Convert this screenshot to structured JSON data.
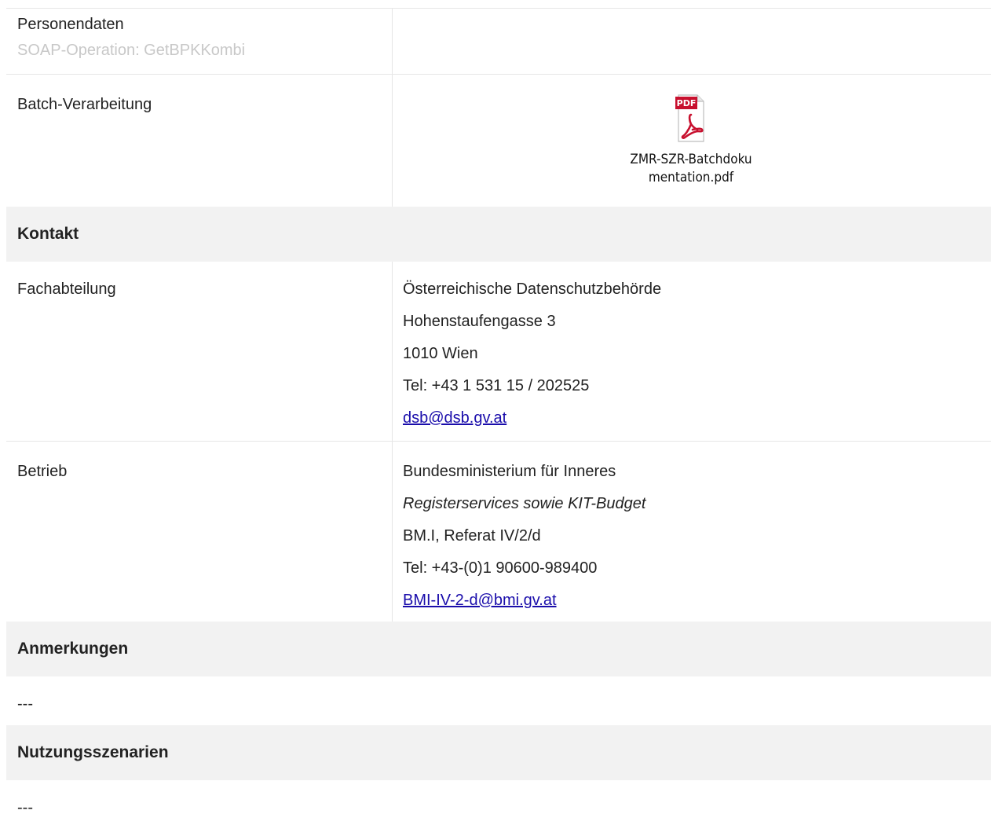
{
  "rows": {
    "personendaten": {
      "label": "Personendaten",
      "sublabel": "SOAP-Operation: GetBPKKombi"
    },
    "batch": {
      "label": "Batch-Verarbeitung",
      "file_name_line1": "ZMR-SZR-Batchdoku",
      "file_name_line2": "mentation.pdf",
      "file_icon": "pdf-icon",
      "icon_text": "PDF"
    }
  },
  "kontakt": {
    "heading": "Kontakt",
    "fachabteilung": {
      "label": "Fachabteilung",
      "name": "Österreichische Datenschutzbehörde",
      "street": "Hohenstaufengasse 3",
      "city": "1010 Wien",
      "tel": "Tel: +43 1 531 15 / 202525",
      "email": "dsb@dsb.gv.at"
    },
    "betrieb": {
      "label": "Betrieb",
      "name": "Bundesministerium für Inneres",
      "unit": "Registerservices sowie KIT-Budget",
      "referat": "BM.I, Referat IV/2/d",
      "tel": "Tel: +43-(0)1 90600-989400",
      "email": "BMI-IV-2-d@bmi.gv.at"
    }
  },
  "anmerkungen": {
    "heading": "Anmerkungen",
    "text": "---"
  },
  "nutzungsszenarien": {
    "heading": "Nutzungsszenarien",
    "text": "---"
  },
  "colors": {
    "link": "#1a0dab",
    "section_bg": "#f2f2f2",
    "border": "#e6e6e6",
    "pdf_red": "#c8102e"
  }
}
